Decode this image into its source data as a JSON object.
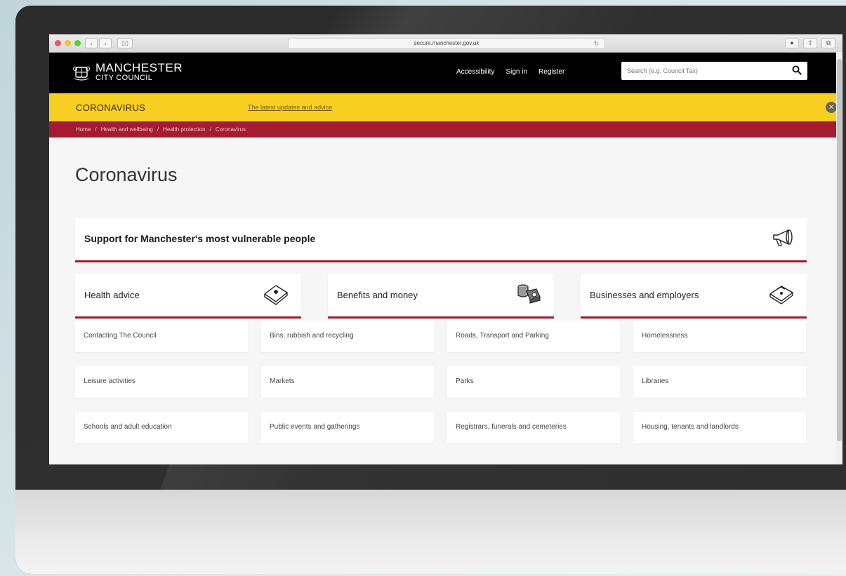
{
  "browser": {
    "url": "secure.manchester.gov.uk",
    "back_icon": "chevron-left-icon",
    "forward_icon": "chevron-right-icon"
  },
  "header": {
    "logo_line1": "MANCHESTER",
    "logo_line2": "CITY COUNCIL",
    "links": [
      "Accessibility",
      "Sign in",
      "Register"
    ],
    "search_placeholder": "Search (e.g. Council Tax)"
  },
  "banner": {
    "title": "CORONAVIRUS",
    "link": "The latest updates and advice",
    "close_icon": "close-icon"
  },
  "breadcrumb": [
    "Home",
    "Health and wellbeing",
    "Health protection",
    "Coronavirus"
  ],
  "page_title": "Coronavirus",
  "support": {
    "label": "Support for Manchester's most vulnerable people",
    "icon": "megaphone-icon"
  },
  "features": [
    {
      "label": "Health advice",
      "icon": "first-aid-icon"
    },
    {
      "label": "Benefits and money",
      "icon": "coins-icon"
    },
    {
      "label": "Businesses and employers",
      "icon": "briefcase-icon"
    }
  ],
  "links": [
    "Contacting The Council",
    "Bins, rubbish and recycling",
    "Roads, Transport and Parking",
    "Homelessness",
    "Leisure activities",
    "Markets",
    "Parks",
    "Libraries",
    "Schools and adult education",
    "Public events and gatherings",
    "Registrars, funerals and cemeteries",
    "Housing, tenants and landlords"
  ],
  "colors": {
    "banner_yellow": "#f8cf23",
    "brand_red": "#a51c30",
    "header_black": "#000000"
  }
}
